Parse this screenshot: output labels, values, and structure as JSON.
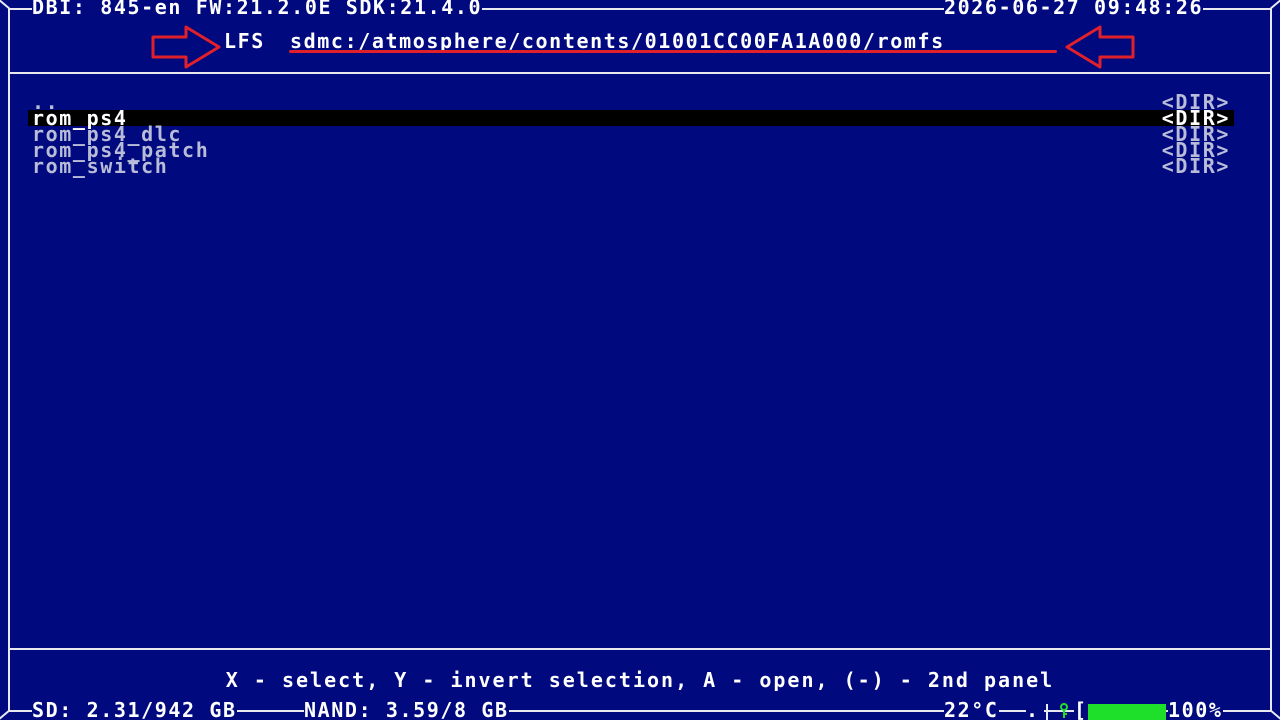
{
  "header": {
    "app_info": "DBI: 845-en FW:21.2.0E SDK:21.4.0",
    "datetime": "2026-06-27 09:48:26",
    "location_label": "LFS",
    "path": "sdmc:/atmosphere/contents/01001CC00FA1A000/romfs"
  },
  "files": [
    {
      "name": "..",
      "tag": "<DIR>",
      "selected": false
    },
    {
      "name": "rom_ps4",
      "tag": "<DIR>",
      "selected": true
    },
    {
      "name": "rom_ps4_dlc",
      "tag": "<DIR>",
      "selected": false
    },
    {
      "name": "rom_ps4_patch",
      "tag": "<DIR>",
      "selected": false
    },
    {
      "name": "rom_switch",
      "tag": "<DIR>",
      "selected": false
    }
  ],
  "hint": "X - select, Y - invert selection, A - open, (-) - 2nd panel",
  "footer": {
    "sd": "SD: 2.31/942 GB",
    "nand": "NAND: 3.59/8 GB",
    "temperature": "22°C",
    "battery": "100%",
    "battery_level": 100,
    "battery_color": "#1ee02a"
  },
  "colors": {
    "background": "#000a7e",
    "selection": "#000000",
    "annotation": "#e0202a"
  }
}
